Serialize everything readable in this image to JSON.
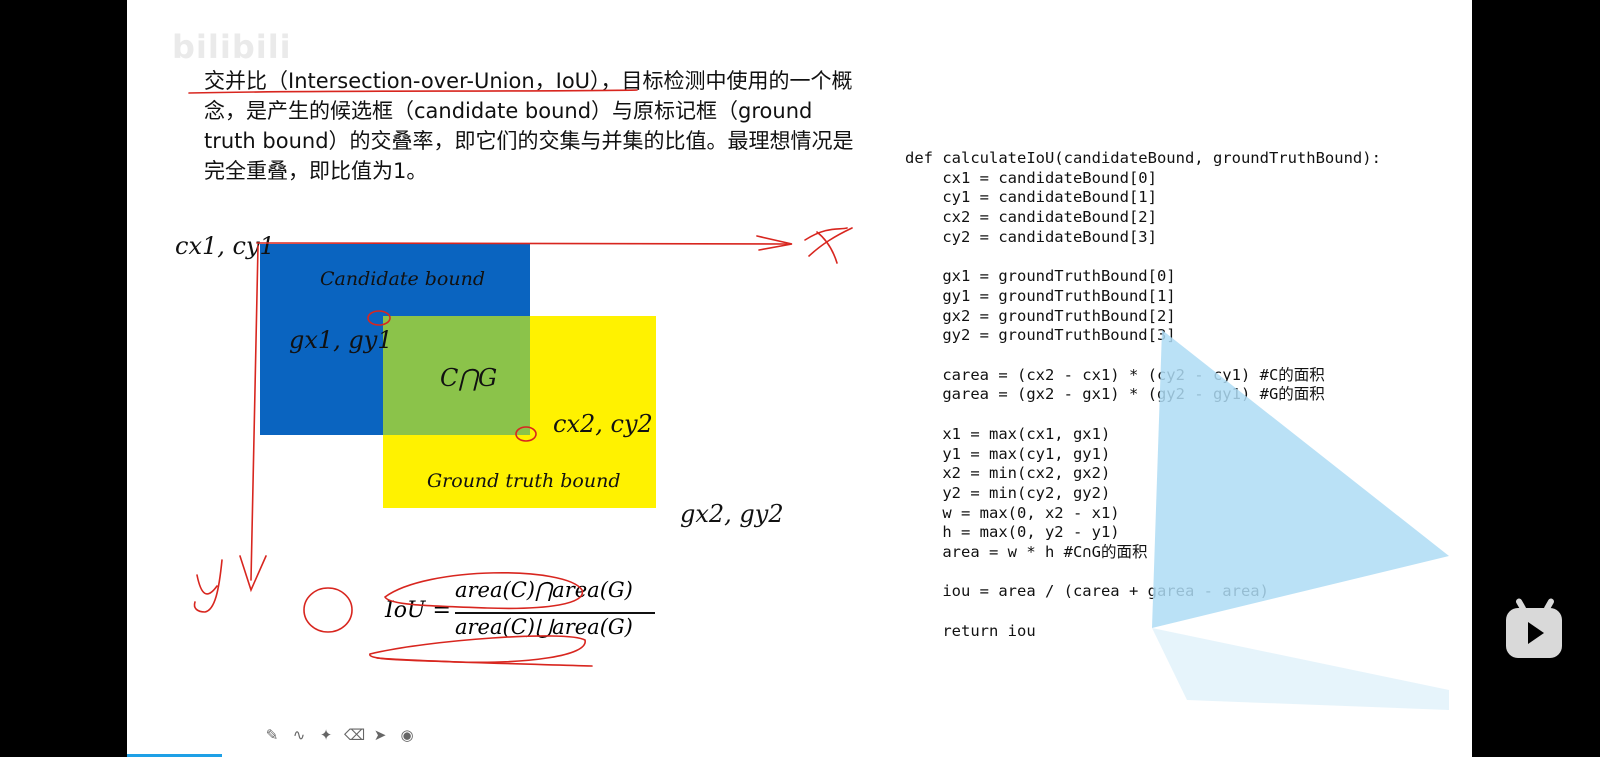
{
  "watermark": "bilibili",
  "description": "交并比（Intersection-over-Union，IoU），目标检测中使用的一个概念，是产生的候选框（candidate bound）与原标记框（ground truth bound）的交叠率，即它们的交集与并集的比值。最理想情况是完全重叠，即比值为1。",
  "diagram": {
    "top_left_label": "cx1, cy1",
    "candidate_label": "Candidate bound",
    "g_top_left_label": "gx1, gy1",
    "intersection_label": "C⋂G",
    "c_bottom_right_label": "cx2, cy2",
    "ground_truth_label": "Ground truth bound",
    "g_bottom_right_label": "gx2, gy2",
    "colors": {
      "candidate": "#0a64c0",
      "ground_truth": "#fff200",
      "intersection": "#8bc34a",
      "annotation": "#d8261f"
    }
  },
  "formula": {
    "lhs": "IoU =",
    "numerator": "area(C)⋂area(G)",
    "denominator": "area(C)⋃area(G)"
  },
  "code": "def calculateIoU(candidateBound, groundTruthBound):\n    cx1 = candidateBound[0]\n    cy1 = candidateBound[1]\n    cx2 = candidateBound[2]\n    cy2 = candidateBound[3]\n\n    gx1 = groundTruthBound[0]\n    gy1 = groundTruthBound[1]\n    gx2 = groundTruthBound[2]\n    gy2 = groundTruthBound[3]\n\n    carea = (cx2 - cx1) * (cy2 - cy1) #C的面积\n    garea = (gx2 - gx1) * (gy2 - gy1) #G的面积\n\n    x1 = max(cx1, gx1)\n    y1 = max(cy1, gy1)\n    x2 = min(cx2, gx2)\n    y2 = min(cy2, gy2)\n    w = max(0, x2 - x1)\n    h = max(0, y2 - y1)\n    area = w * h #C∩G的面积\n\n    iou = area / (carea + garea - area)\n\n    return iou",
  "toolbar": {
    "tools": [
      "pen-icon",
      "curve-icon",
      "marker-icon",
      "eraser-icon",
      "pointer-icon",
      "record-icon"
    ],
    "glyphs": [
      "✎",
      "∿",
      "✦",
      "⌫",
      "➤",
      "◉"
    ]
  },
  "video": {
    "play_icon": "play-icon",
    "accent": "#1ea0e6"
  }
}
